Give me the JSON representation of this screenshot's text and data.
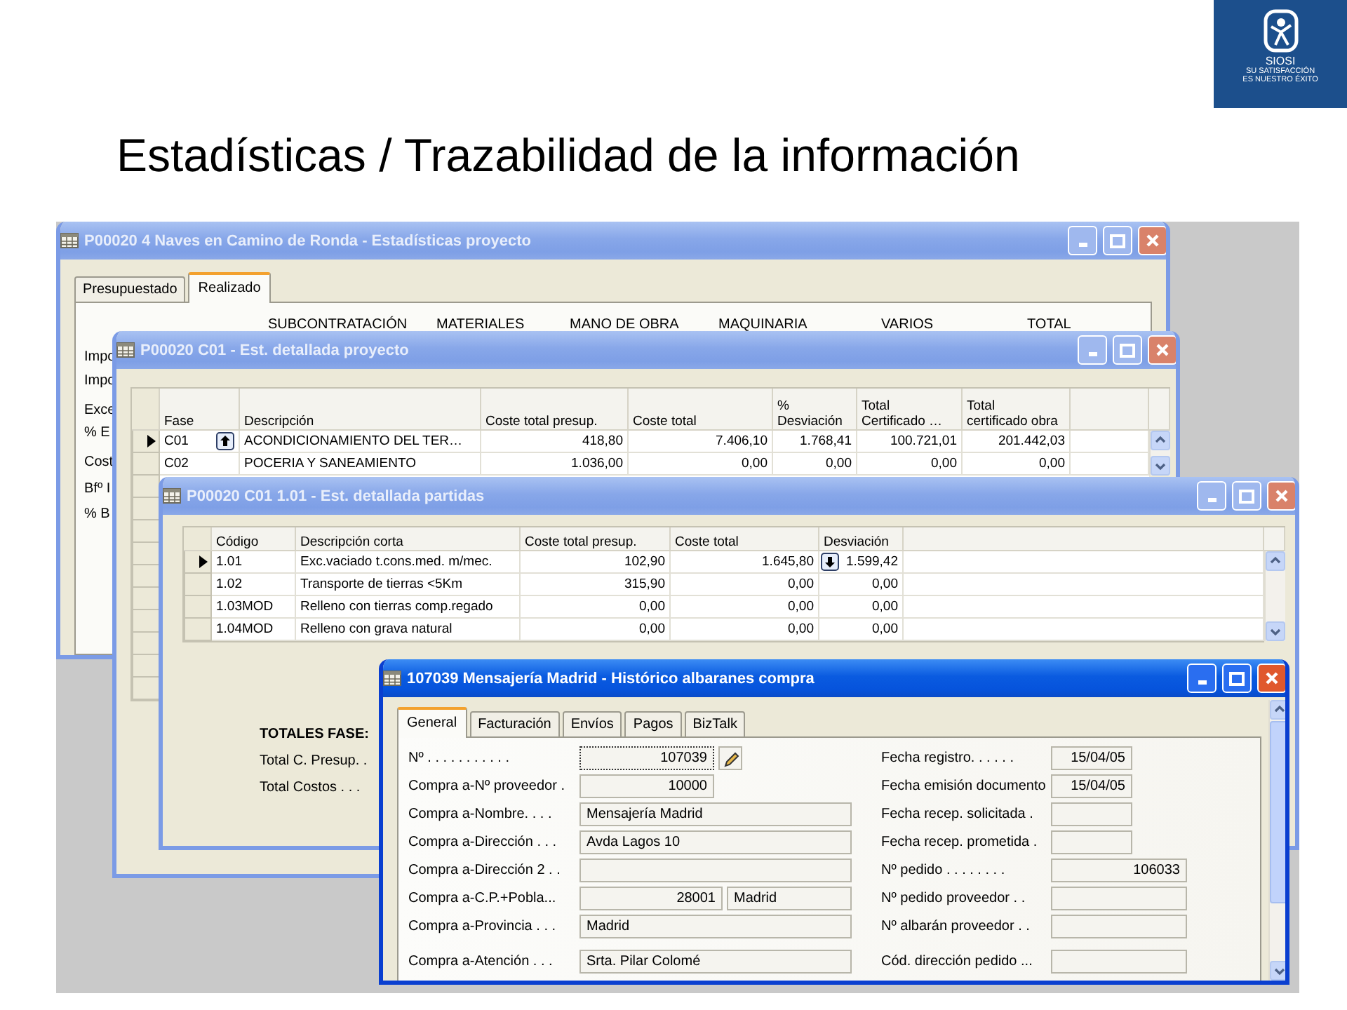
{
  "slide_title": "Estadísticas / Trazabilidad de la información",
  "logo": {
    "name": "SIOSI",
    "tagline": [
      "SU SATISFACCIÓN",
      "ES NUESTRO ÉXITO"
    ]
  },
  "windows": [
    {
      "kind": "stats",
      "active": false,
      "title": "P00020 4 Naves en Camino de Ronda - Estadísticas proyecto",
      "tabs": [
        {
          "label": "Presupuestado",
          "selected": false
        },
        {
          "label": "Realizado",
          "selected": true
        }
      ],
      "columns": [
        "SUBCONTRATACIÓN",
        "MATERIALES",
        "MANO DE OBRA",
        "MAQUINARIA",
        "VARIOS",
        "TOTAL"
      ],
      "row_labels": [
        "Impo",
        "Impo",
        "Exce",
        "% E",
        "Cost",
        "Bfº I",
        "% B"
      ]
    },
    {
      "kind": "grid",
      "active": false,
      "title": "P00020 C01 - Est. detallada proyecto",
      "columns": [
        "Fase",
        "Descripción",
        "Coste total presup.",
        "Coste total",
        "%\nDesviación",
        "Total\nCertificado …",
        "Total\ncertificado obra"
      ],
      "rows": [
        {
          "selected": true,
          "cells": [
            {
              "text": "C01",
              "kind": "up"
            },
            "ACONDICIONAMIENTO DEL TER…",
            "418,80",
            "7.406,10",
            "1.768,41",
            "100.721,01",
            "201.442,03"
          ]
        },
        {
          "selected": false,
          "cells": [
            "C02",
            "POCERIA Y SANEAMIENTO",
            "1.036,00",
            "0,00",
            "0,00",
            "0,00",
            "0,00"
          ]
        }
      ]
    },
    {
      "kind": "grid",
      "active": false,
      "title": "P00020 C01 1.01 - Est. detallada partidas",
      "columns": [
        "Código",
        "Descripción corta",
        "Coste total presup.",
        "Coste total",
        "Desviación"
      ],
      "rows": [
        {
          "selected": true,
          "cells": [
            "1.01",
            "Exc.vaciado t.cons.med. m/mec.",
            "102,90",
            "1.645,80",
            {
              "text": "1.599,42",
              "kind": "down"
            }
          ]
        },
        {
          "selected": false,
          "cells": [
            "1.02",
            "Transporte de tierras <5Km",
            "315,90",
            "0,00",
            "0,00"
          ]
        },
        {
          "selected": false,
          "cells": [
            "1.03MOD",
            "Relleno con tierras comp.regado",
            "0,00",
            "0,00",
            "0,00"
          ]
        },
        {
          "selected": false,
          "cells": [
            "1.04MOD",
            "Relleno con grava natural",
            "0,00",
            "0,00",
            "0,00"
          ]
        }
      ],
      "totals": {
        "heading": "TOTALES FASE:",
        "labels": [
          "Total C. Presup. .",
          "Total Costos . . ."
        ]
      }
    },
    {
      "kind": "form",
      "active": true,
      "title": "107039 Mensajería Madrid - Histórico albaranes compra",
      "tabs": [
        {
          "label": "General",
          "selected": true
        },
        {
          "label": "Facturación",
          "selected": false
        },
        {
          "label": "Envíos",
          "selected": false
        },
        {
          "label": "Pagos",
          "selected": false
        },
        {
          "label": "BizTalk",
          "selected": false
        }
      ],
      "left_fields": [
        {
          "label": "Nº . . . . . . . . . . .",
          "kind": "number",
          "value": "107039",
          "focused": true,
          "edit_button": true
        },
        {
          "label": "Compra a-Nº proveedor .",
          "kind": "number",
          "value": "10000",
          "focused": false,
          "edit_button": false
        },
        {
          "label": "Compra a-Nombre. . . .",
          "kind": "text",
          "value": "Mensajería Madrid",
          "focused": false,
          "edit_button": false
        },
        {
          "label": "Compra a-Dirección . . .",
          "kind": "text",
          "value": "Avda Lagos 10",
          "focused": false,
          "edit_button": false
        },
        {
          "label": "Compra a-Dirección 2 . .",
          "kind": "text",
          "focused": false,
          "edit_button": false
        },
        {
          "label": "Compra a-C.P.+Pobla...",
          "kind": "postcode",
          "value": "28001",
          "value_2": "Madrid",
          "focused": false,
          "edit_button": false
        },
        {
          "label": "Compra a-Provincia . . .",
          "kind": "text",
          "value": "Madrid",
          "focused": false,
          "edit_button": false
        },
        {
          "label": "Compra a-Atención . . .",
          "kind": "text",
          "value": "Srta. Pilar Colomé",
          "focused": false,
          "edit_button": false
        }
      ],
      "right_fields": [
        {
          "label": "Fecha registro. . . . . .",
          "kind": "date",
          "value": "15/04/05"
        },
        {
          "label": "Fecha emisión documento",
          "kind": "date",
          "value": "15/04/05"
        },
        {
          "label": "Fecha recep. solicitada .",
          "kind": "date"
        },
        {
          "label": "Fecha recep. prometida .",
          "kind": "date"
        },
        {
          "label": "Nº pedido . . . . . . . .",
          "kind": "number",
          "value": "106033"
        },
        {
          "label": "Nº pedido proveedor . .",
          "kind": "text"
        },
        {
          "label": "Nº albarán proveedor . .",
          "kind": "text"
        },
        {
          "label": "Cód. dirección pedido ...",
          "kind": "text"
        }
      ]
    }
  ]
}
